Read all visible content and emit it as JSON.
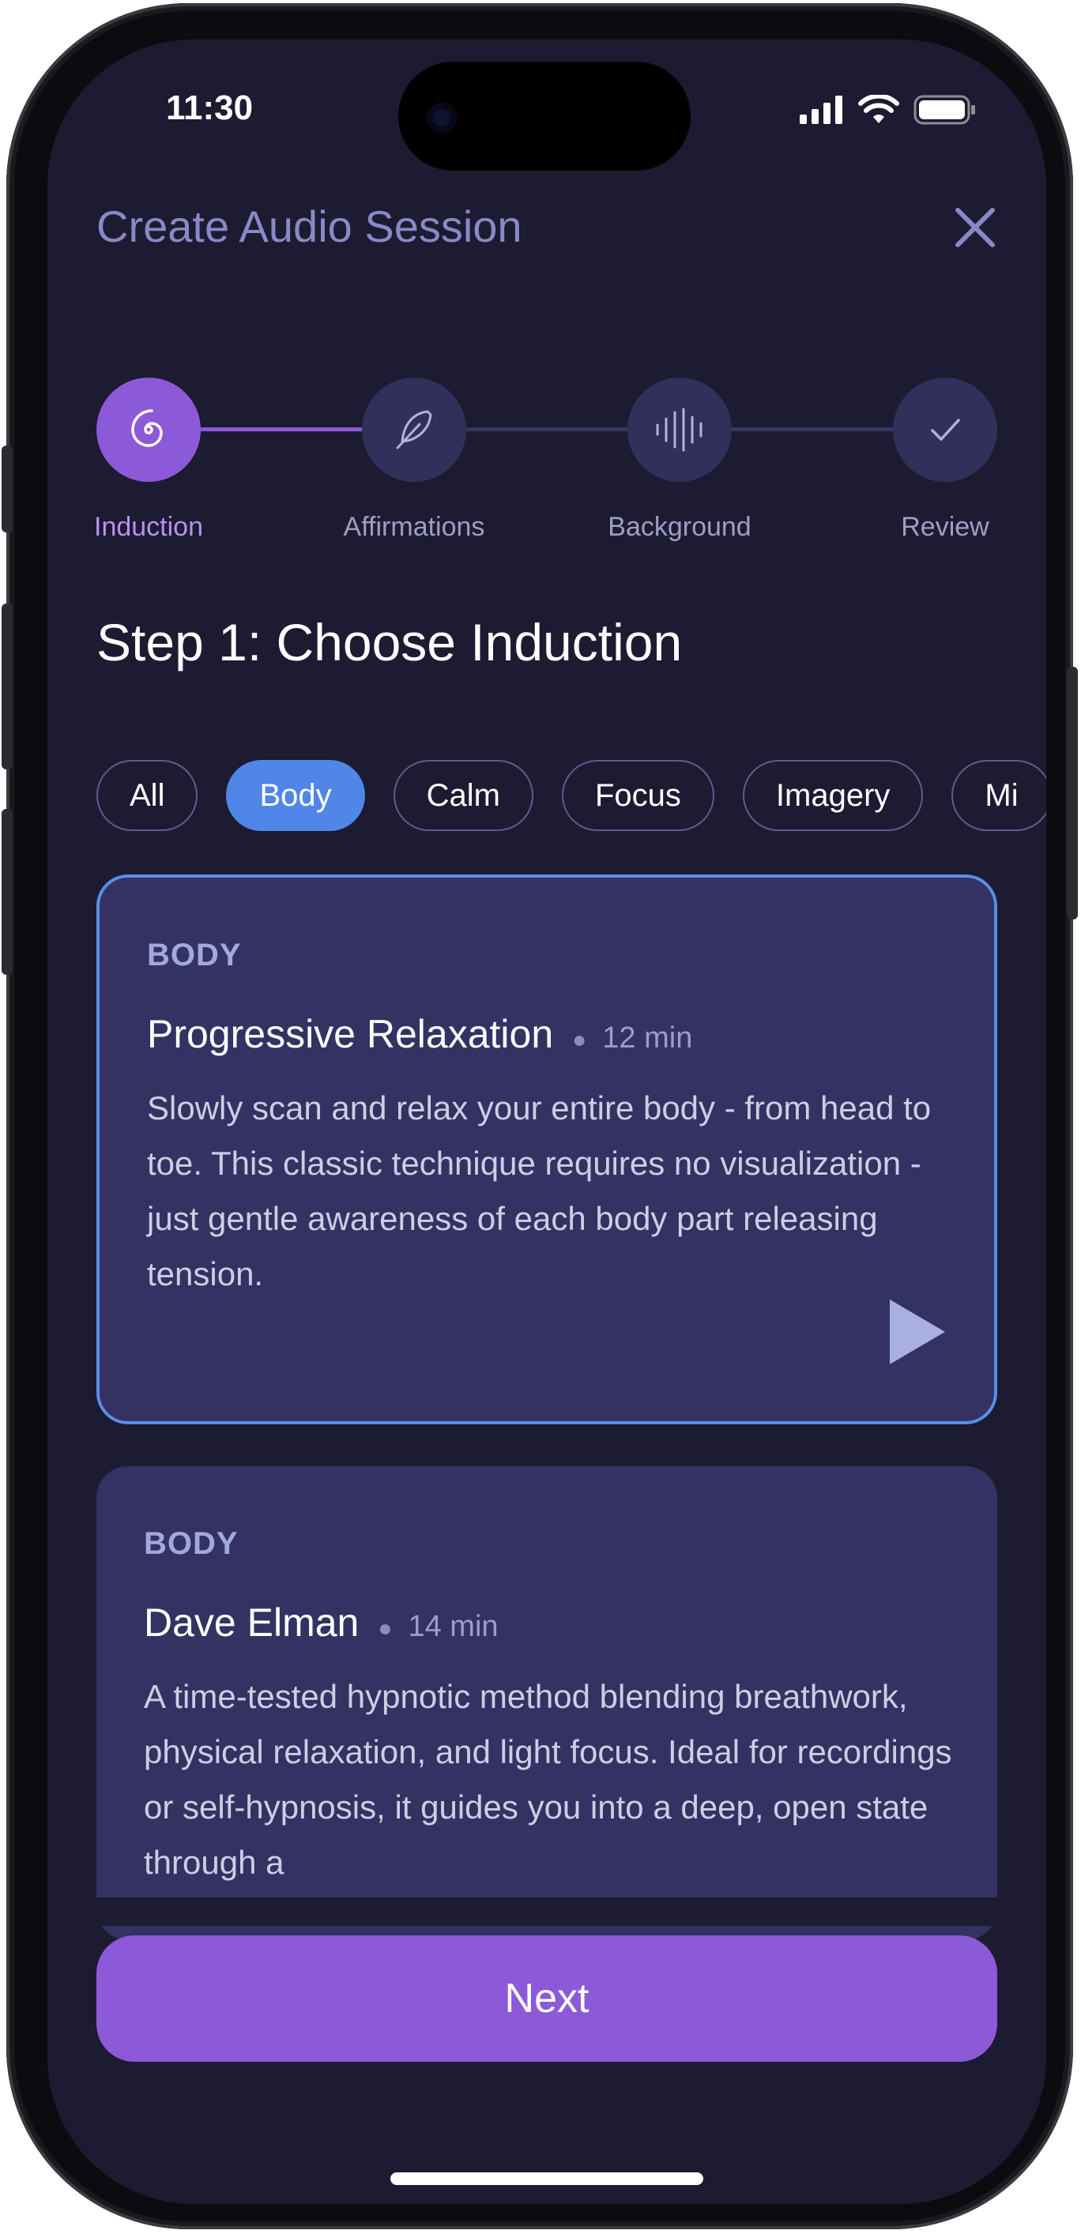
{
  "status": {
    "time": "11:30"
  },
  "header": {
    "title": "Create Audio Session"
  },
  "stepper": {
    "steps": [
      {
        "label": "Induction",
        "icon": "spiral-icon",
        "active": true
      },
      {
        "label": "Affirmations",
        "icon": "feather-icon",
        "active": false
      },
      {
        "label": "Background",
        "icon": "waveform-icon",
        "active": false
      },
      {
        "label": "Review",
        "icon": "checkmark-icon",
        "active": false
      }
    ]
  },
  "step_heading": "Step 1: Choose Induction",
  "filters": {
    "chips": [
      "All",
      "Body",
      "Calm",
      "Focus",
      "Imagery",
      "Mi"
    ],
    "selected": "Body"
  },
  "cards": [
    {
      "category": "BODY",
      "title": "Progressive Relaxation",
      "duration": "12 min",
      "description": "Slowly scan and relax your entire body - from head to toe. This classic technique requires no visualization - just gentle awareness of each body part releasing tension.",
      "selected": true
    },
    {
      "category": "BODY",
      "title": "Dave Elman",
      "duration": "14 min",
      "description": "A time-tested hypnotic method blending breathwork, physical relaxation, and light focus. Ideal for recordings or self-hypnosis, it guides you into a deep, open state through a",
      "selected": false
    }
  ],
  "footer": {
    "next_label": "Next"
  },
  "colors": {
    "background": "#1c1b31",
    "accent_purple": "#8c5ad8",
    "accent_blue": "#4f86e8",
    "card": "#333262"
  }
}
